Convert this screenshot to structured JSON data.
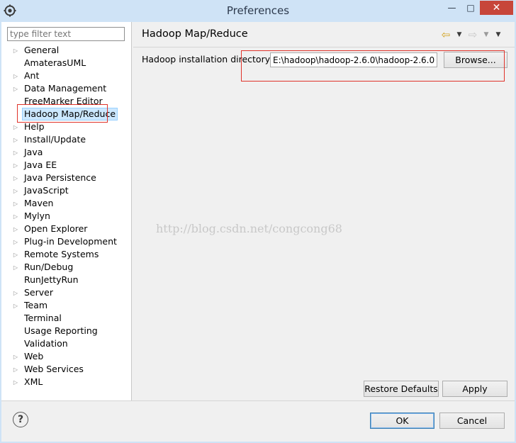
{
  "window": {
    "title": "Preferences",
    "minimize_glyph": "—",
    "maximize_glyph": "□",
    "close_glyph": "✕",
    "icon": "eclipse-gear-icon"
  },
  "filter": {
    "placeholder": "type filter text"
  },
  "tree": {
    "items": [
      {
        "label": "General",
        "expandable": true
      },
      {
        "label": "AmaterasUML",
        "expandable": false
      },
      {
        "label": "Ant",
        "expandable": true
      },
      {
        "label": "Data Management",
        "expandable": true
      },
      {
        "label": "FreeMarker Editor",
        "expandable": false
      },
      {
        "label": "Hadoop Map/Reduce",
        "expandable": false,
        "selected": true
      },
      {
        "label": "Help",
        "expandable": true
      },
      {
        "label": "Install/Update",
        "expandable": true
      },
      {
        "label": "Java",
        "expandable": true
      },
      {
        "label": "Java EE",
        "expandable": true
      },
      {
        "label": "Java Persistence",
        "expandable": true
      },
      {
        "label": "JavaScript",
        "expandable": true
      },
      {
        "label": "Maven",
        "expandable": true
      },
      {
        "label": "Mylyn",
        "expandable": true
      },
      {
        "label": "Open Explorer",
        "expandable": true
      },
      {
        "label": "Plug-in Development",
        "expandable": true
      },
      {
        "label": "Remote Systems",
        "expandable": true
      },
      {
        "label": "Run/Debug",
        "expandable": true
      },
      {
        "label": "RunJettyRun",
        "expandable": false
      },
      {
        "label": "Server",
        "expandable": true
      },
      {
        "label": "Team",
        "expandable": true
      },
      {
        "label": "Terminal",
        "expandable": false
      },
      {
        "label": "Usage Reporting",
        "expandable": false
      },
      {
        "label": "Validation",
        "expandable": false
      },
      {
        "label": "Web",
        "expandable": true
      },
      {
        "label": "Web Services",
        "expandable": true
      },
      {
        "label": "XML",
        "expandable": true
      }
    ]
  },
  "page": {
    "title": "Hadoop Map/Reduce",
    "dir_label": "Hadoop installation directory:",
    "dir_value": "E:\\hadoop\\hadoop-2.6.0\\hadoop-2.6.0",
    "browse_label": "Browse...",
    "restore_label": "Restore Defaults",
    "apply_label": "Apply",
    "nav": {
      "back_glyph": "⇦",
      "forward_glyph": "⇨",
      "dropdown_glyph": "▼"
    }
  },
  "watermark": "http://blog.csdn.net/congcong68",
  "footer": {
    "help_glyph": "?",
    "ok_label": "OK",
    "cancel_label": "Cancel"
  },
  "colors": {
    "annotation_red": "#e0332a",
    "selection_bg": "#cce8ff",
    "close_button": "#c7463a"
  }
}
